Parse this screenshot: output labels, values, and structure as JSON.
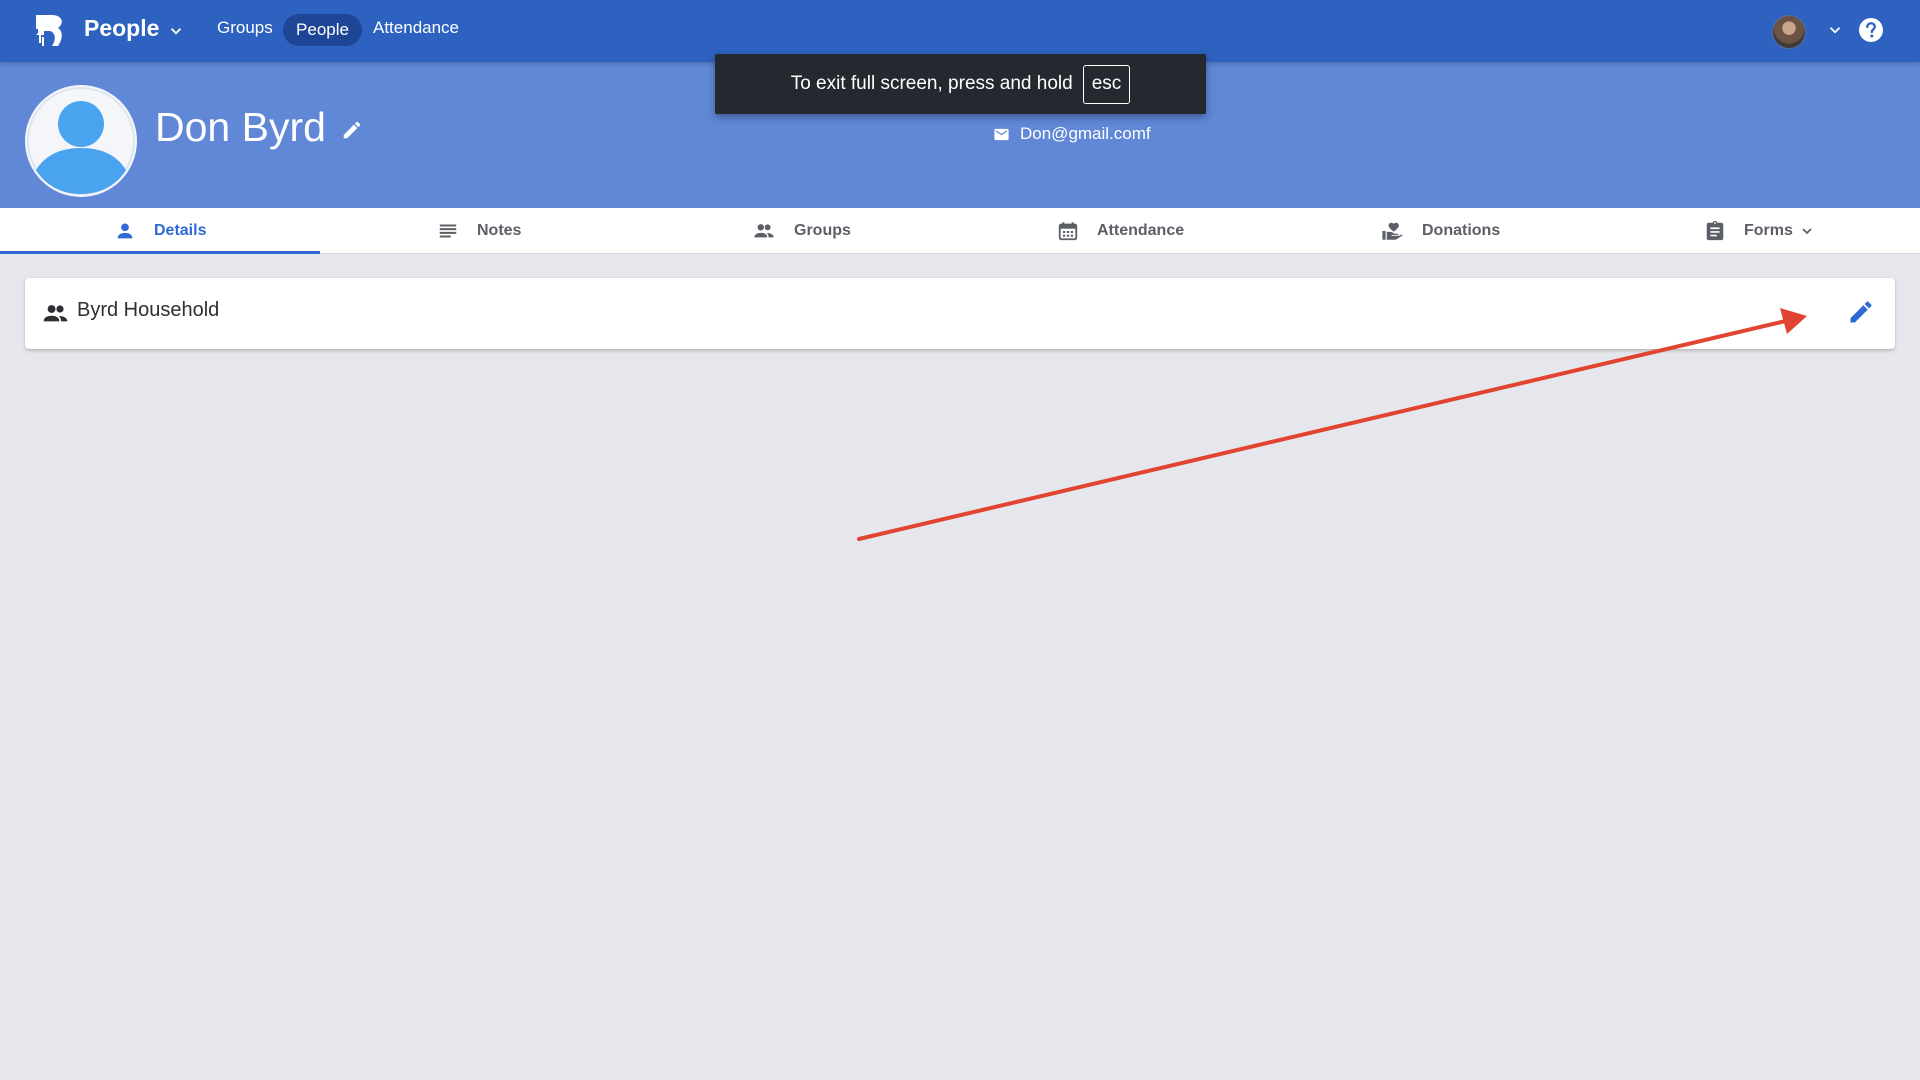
{
  "topbar": {
    "app_title": "People",
    "nav_links": [
      "Groups",
      "People",
      "Attendance"
    ],
    "active_nav": "People",
    "icons": {
      "logo": "b1-logo-icon",
      "app_menu": "chevron-down-icon",
      "user_avatar": "user-avatar",
      "user_menu": "chevron-down-icon",
      "help": "help-circle-icon"
    },
    "colors": {
      "bar": "#2e62c0",
      "active_pill": "#1e4596"
    }
  },
  "fullscreen_toast": {
    "message": "To exit full screen, press and hold",
    "key": "esc"
  },
  "profile": {
    "name": "Don Byrd",
    "email": "Don@gmail.comf",
    "icons": {
      "avatar": "person-avatar-icon",
      "edit": "pencil-icon",
      "email": "envelope-icon"
    },
    "colors": {
      "header": "#6088d7"
    }
  },
  "tabs": [
    {
      "label": "Details",
      "icon": "person-icon",
      "active": true
    },
    {
      "label": "Notes",
      "icon": "notes-icon",
      "active": false
    },
    {
      "label": "Groups",
      "icon": "people-icon",
      "active": false
    },
    {
      "label": "Attendance",
      "icon": "calendar-icon",
      "active": false
    },
    {
      "label": "Donations",
      "icon": "donation-hand-icon",
      "active": false
    },
    {
      "label": "Forms",
      "icon": "clipboard-icon",
      "active": false,
      "has_dropdown": true
    }
  ],
  "household": {
    "title": "Byrd Household",
    "icons": {
      "household": "people-icon",
      "edit": "pencil-icon"
    },
    "colors": {
      "edit": "#2d6bd3"
    }
  },
  "annotation": {
    "type": "arrow",
    "color": "#e14431",
    "points_to": "household-edit-button"
  }
}
